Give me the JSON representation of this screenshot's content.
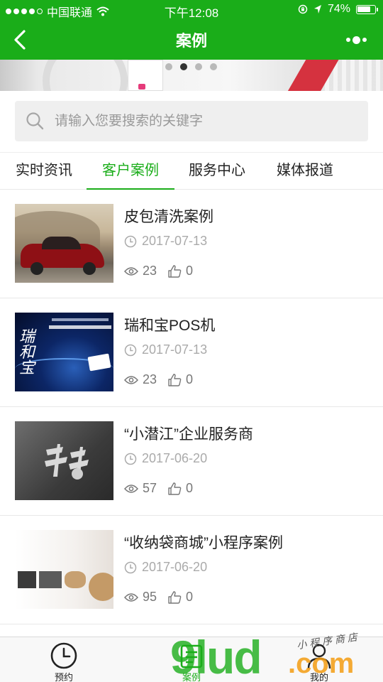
{
  "status_bar": {
    "carrier": "中国联通",
    "time": "下午12:08",
    "battery": "74%"
  },
  "nav": {
    "title": "案例"
  },
  "banner": {
    "slide_count": 4,
    "active_index": 1
  },
  "search": {
    "placeholder": "请输入您要搜索的关键字"
  },
  "tabs": [
    {
      "label": "实时资讯",
      "active": false
    },
    {
      "label": "客户案例",
      "active": true
    },
    {
      "label": "服务中心",
      "active": false
    },
    {
      "label": "媒体报道",
      "active": false
    }
  ],
  "cases": [
    {
      "title": "皮包清洗案例",
      "date": "2017-07-13",
      "views": "23",
      "likes": "0"
    },
    {
      "title": "瑞和宝POS机",
      "date": "2017-07-13",
      "views": "23",
      "likes": "0"
    },
    {
      "title": "“小潜江”企业服务商",
      "date": "2017-06-20",
      "views": "57",
      "likes": "0"
    },
    {
      "title": "“收纳袋商城”小程序案例",
      "date": "2017-06-20",
      "views": "95",
      "likes": "0"
    }
  ],
  "tabbar": [
    {
      "label": "预约",
      "icon": "clock-icon",
      "active": false
    },
    {
      "label": "案例",
      "icon": "cases-icon",
      "active": true
    },
    {
      "label": "我的",
      "icon": "user-icon",
      "active": false
    }
  ],
  "watermark": {
    "brand": "9lud",
    "suffix": ".com",
    "script": "小程序商店"
  },
  "colors": {
    "primary": "#1aad19",
    "nav_text": "#ffffff",
    "muted": "#aaaaaa"
  }
}
